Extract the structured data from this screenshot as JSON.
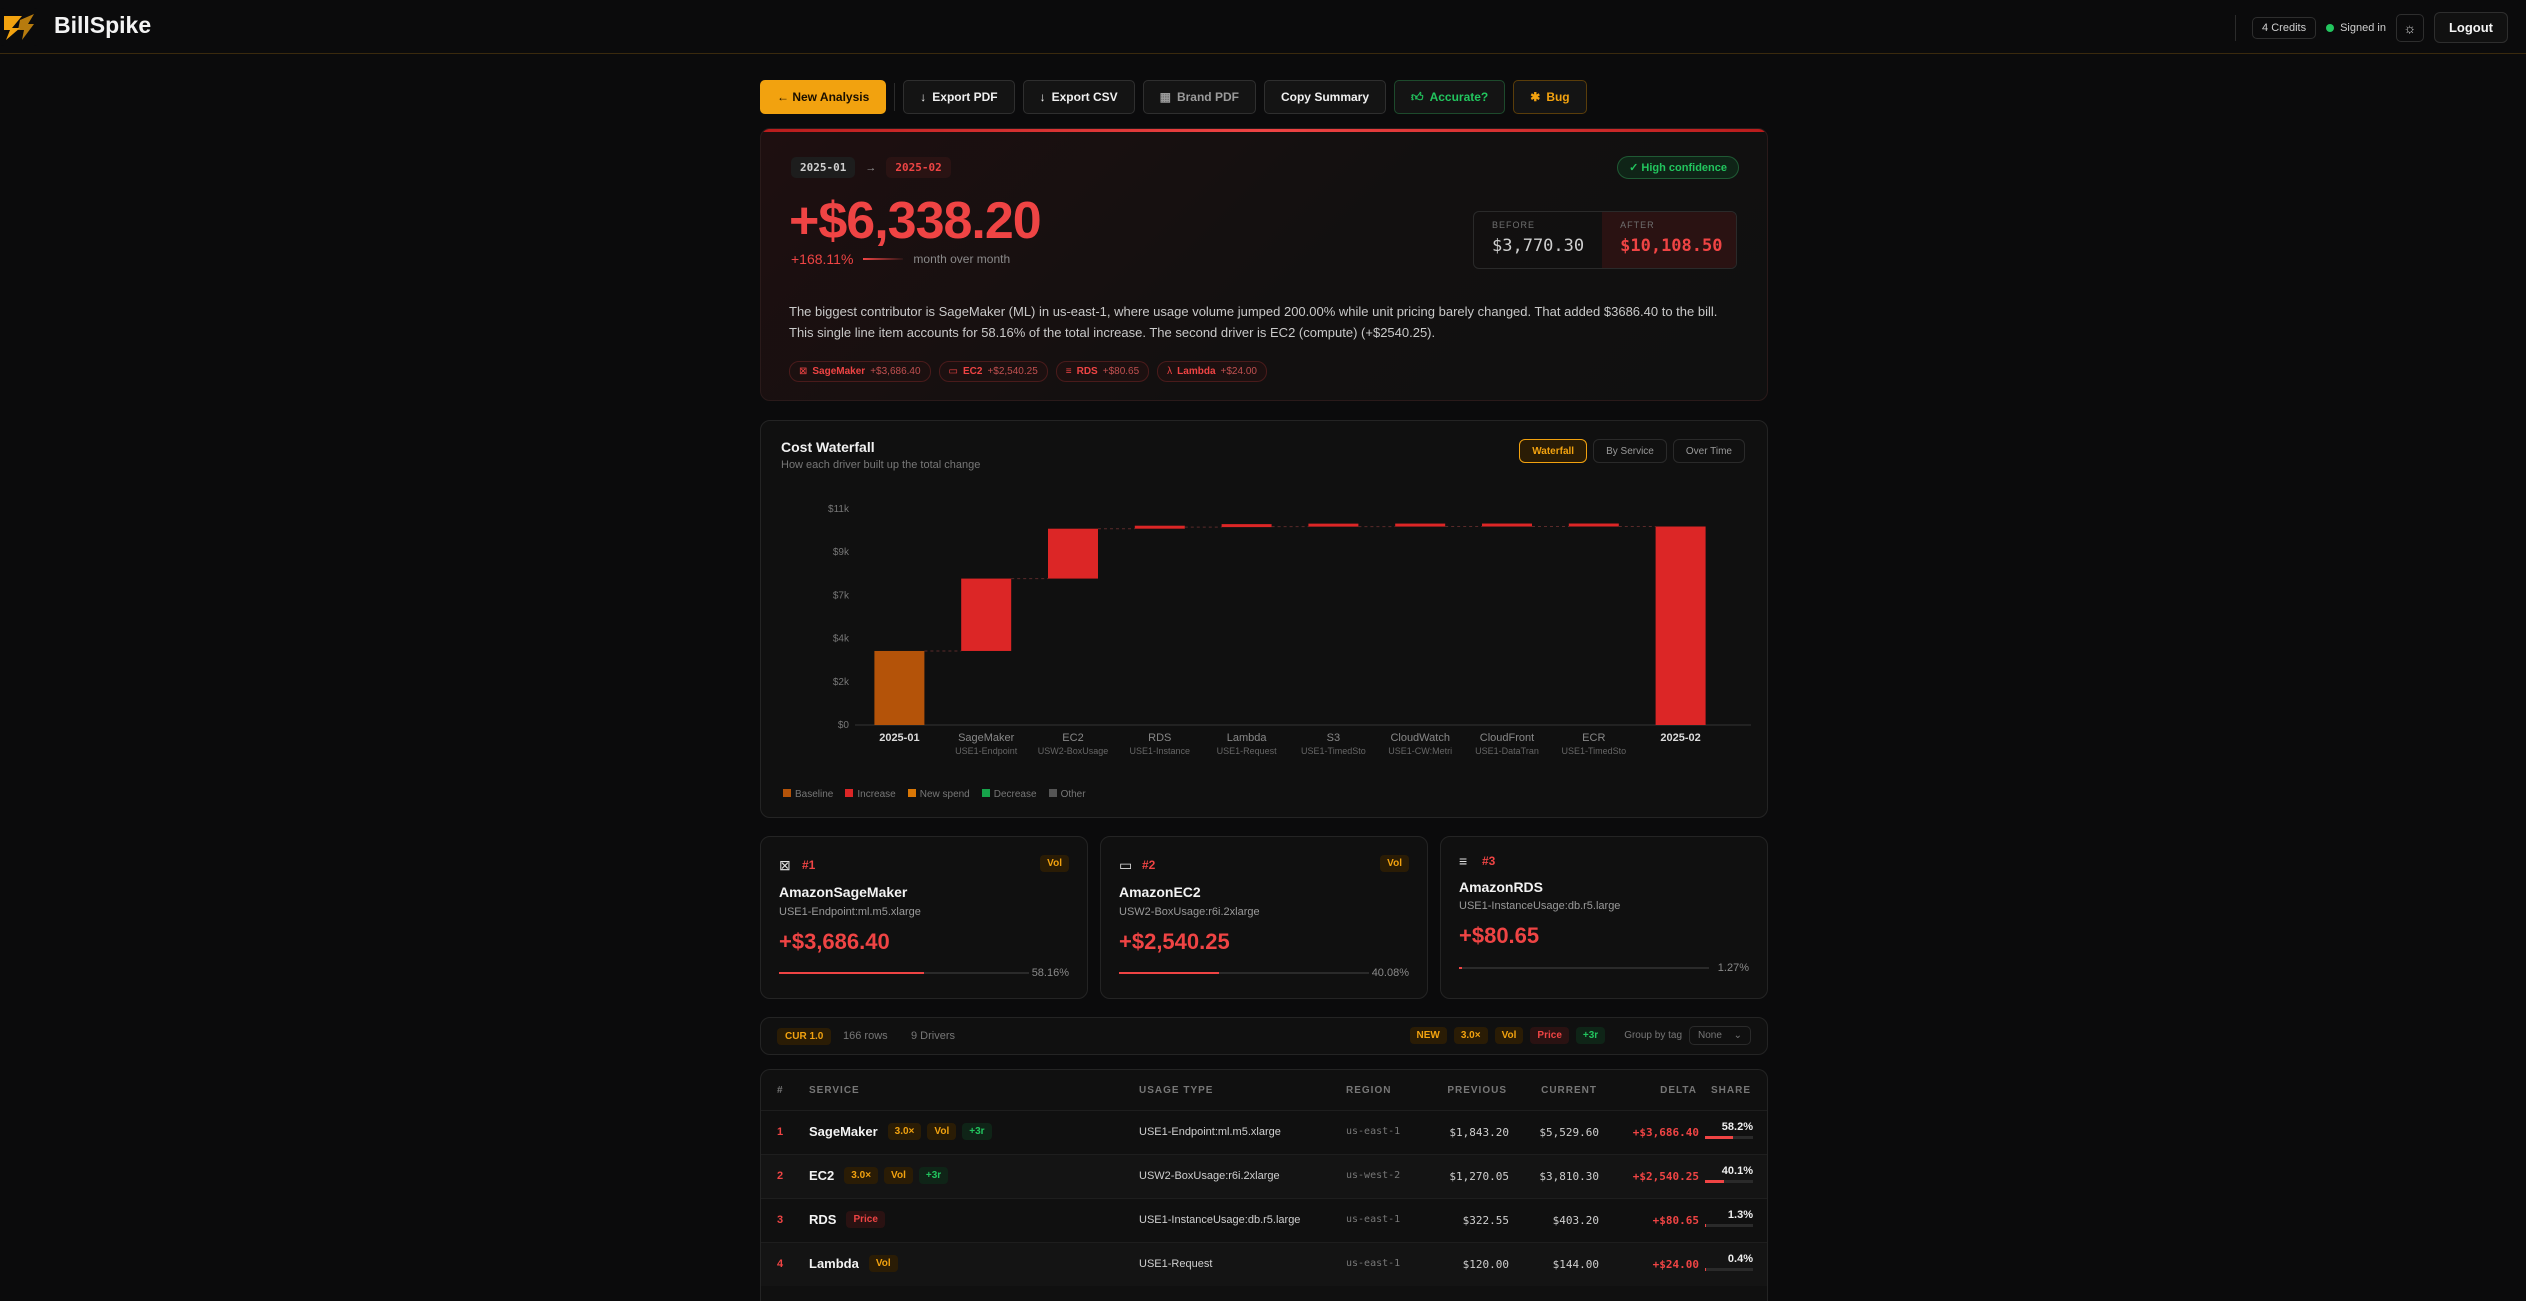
{
  "app": {
    "brand": "BillSpike",
    "credits": "4 Credits",
    "signed_in": "Signed in",
    "logout": "Logout",
    "colors": {
      "accent": "#f2a20f",
      "increase": "#ef4444",
      "decrease": "#22c55e"
    }
  },
  "toolbar": {
    "new_analysis": "← New Analysis",
    "export_pdf": "Export PDF",
    "export_csv": "Export CSV",
    "brand_pdf": "Brand PDF",
    "copy_summary": "Copy Summary",
    "accurate": "Accurate?",
    "bug": "Bug"
  },
  "summary": {
    "period_from": "2025-01",
    "period_arrow": "→",
    "period_to": "2025-02",
    "confidence": "✓ High confidence",
    "delta": "+$6,338.20",
    "pct": "+168.11%",
    "pct_caption": "month over month",
    "before_label": "BEFORE",
    "before_value": "$3,770.30",
    "after_label": "AFTER",
    "after_value": "$10,108.50",
    "narrative": "The biggest contributor is SageMaker (ML) in us-east-1, where usage volume jumped 200.00% while unit pricing barely changed. That added $3686.40 to the bill. This single line item accounts for 58.16% of the total increase. The second driver is EC2 (compute) (+$2540.25).",
    "chips": [
      {
        "name": "SageMaker",
        "amount": "+$3,686.40",
        "icon": "sagemaker-icon"
      },
      {
        "name": "EC2",
        "amount": "+$2,540.25",
        "icon": "monitor-icon"
      },
      {
        "name": "RDS",
        "amount": "+$80.65",
        "icon": "database-icon"
      },
      {
        "name": "Lambda",
        "amount": "+$24.00",
        "icon": "lambda-icon"
      }
    ]
  },
  "waterfall": {
    "title": "Cost Waterfall",
    "subtitle": "How each driver built up the total change",
    "tabs": [
      "Waterfall",
      "By Service",
      "Over Time"
    ],
    "active_tab": "Waterfall",
    "legend": [
      "Baseline",
      "Increase",
      "New spend",
      "Decrease",
      "Other"
    ]
  },
  "chart_data": {
    "type": "bar",
    "subtype": "waterfall",
    "title": "Cost Waterfall",
    "yticks": [
      "$0",
      "$2k",
      "$4k",
      "$7k",
      "$9k",
      "$11k"
    ],
    "ylim": [
      0,
      11000
    ],
    "categories": [
      "2025-01",
      "SageMaker",
      "EC2",
      "RDS",
      "Lambda",
      "S3",
      "CloudWatch",
      "CloudFront",
      "ECR",
      "2025-02"
    ],
    "sublabels": [
      "",
      "USE1-Endpoint",
      "USW2-BoxUsage",
      "USE1-Instance",
      "USE1-Request",
      "USE1-TimedSto",
      "USE1-CW:Metri",
      "USE1-DataTran",
      "USE1-TimedSto",
      ""
    ],
    "kinds": [
      "baseline",
      "increase",
      "increase",
      "increase",
      "increase",
      "increase",
      "increase",
      "increase",
      "increase",
      "total"
    ],
    "values": [
      3770.3,
      3686.4,
      2540.25,
      80.65,
      24,
      3.2,
      1.8,
      1.1,
      0.6,
      10108.5
    ],
    "grid": false
  },
  "drivers": [
    {
      "rank": "#1",
      "service": "AmazonSageMaker",
      "usage_type": "USE1-Endpoint:ml.m5.xlarge",
      "amount": "+$3,686.40",
      "share": "58.16%",
      "share_value": 58.16,
      "tag": "Vol",
      "icon": "sagemaker-icon"
    },
    {
      "rank": "#2",
      "service": "AmazonEC2",
      "usage_type": "USW2-BoxUsage:r6i.2xlarge",
      "amount": "+$2,540.25",
      "share": "40.08%",
      "share_value": 40.08,
      "tag": "Vol",
      "icon": "monitor-icon"
    },
    {
      "rank": "#3",
      "service": "AmazonRDS",
      "usage_type": "USE1-InstanceUsage:db.r5.large",
      "amount": "+$80.65",
      "share": "1.27%",
      "share_value": 1.27,
      "tag": "",
      "icon": "database-icon"
    }
  ],
  "table_bar": {
    "cur": "CUR 1.0",
    "rows": "166 rows",
    "drivers": "9 Drivers",
    "badges": [
      "NEW",
      "3.0×",
      "Vol",
      "Price",
      "+3r"
    ],
    "group_by_label": "Group by tag",
    "group_by_value": "None"
  },
  "table": {
    "headers": [
      "#",
      "SERVICE",
      "USAGE TYPE",
      "REGION",
      "PREVIOUS",
      "CURRENT",
      "DELTA",
      "SHARE"
    ],
    "rows": [
      {
        "num": "1",
        "service": "SageMaker",
        "badges": [
          "3.0×",
          "Vol",
          "+3r"
        ],
        "usage_type": "USE1-Endpoint:ml.m5.xlarge",
        "region": "us-east-1",
        "previous": "$1,843.20",
        "current": "$5,529.60",
        "delta": "+$3,686.40",
        "share": "58.2%",
        "share_value": 58.2
      },
      {
        "num": "2",
        "service": "EC2",
        "badges": [
          "3.0×",
          "Vol",
          "+3r"
        ],
        "usage_type": "USW2-BoxUsage:r6i.2xlarge",
        "region": "us-west-2",
        "previous": "$1,270.05",
        "current": "$3,810.30",
        "delta": "+$2,540.25",
        "share": "40.1%",
        "share_value": 40.1
      },
      {
        "num": "3",
        "service": "RDS",
        "badges": [
          "Price"
        ],
        "usage_type": "USE1-InstanceUsage:db.r5.large",
        "region": "us-east-1",
        "previous": "$322.55",
        "current": "$403.20",
        "delta": "+$80.65",
        "share": "1.3%",
        "share_value": 1.3
      },
      {
        "num": "4",
        "service": "Lambda",
        "badges": [
          "Vol"
        ],
        "usage_type": "USE1-Request",
        "region": "us-east-1",
        "previous": "$120.00",
        "current": "$144.00",
        "delta": "+$24.00",
        "share": "0.4%",
        "share_value": 0.4
      }
    ]
  }
}
